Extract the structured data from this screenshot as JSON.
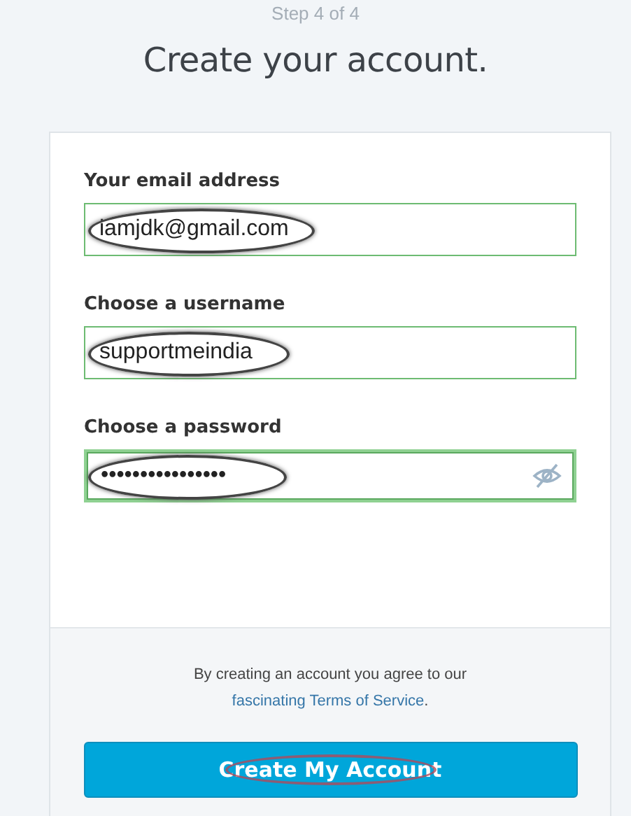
{
  "step": "Step 4 of 4",
  "title": "Create your account.",
  "fields": [
    {
      "label": "Your email address",
      "value": "iamjdk@gmail.com",
      "focused": false,
      "circled": true,
      "kind": "text"
    },
    {
      "label": "Choose a username",
      "value": "supportmeindia",
      "focused": false,
      "circled": true,
      "kind": "text"
    },
    {
      "label": "Choose a password",
      "value": "••••••••••••••••",
      "focused": true,
      "circled": true,
      "kind": "password"
    }
  ],
  "terms": {
    "text": "By creating an account you agree to our",
    "link": "fascinating Terms of Service",
    "end": "."
  },
  "button": {
    "label": "Create My Account",
    "circled": true
  }
}
